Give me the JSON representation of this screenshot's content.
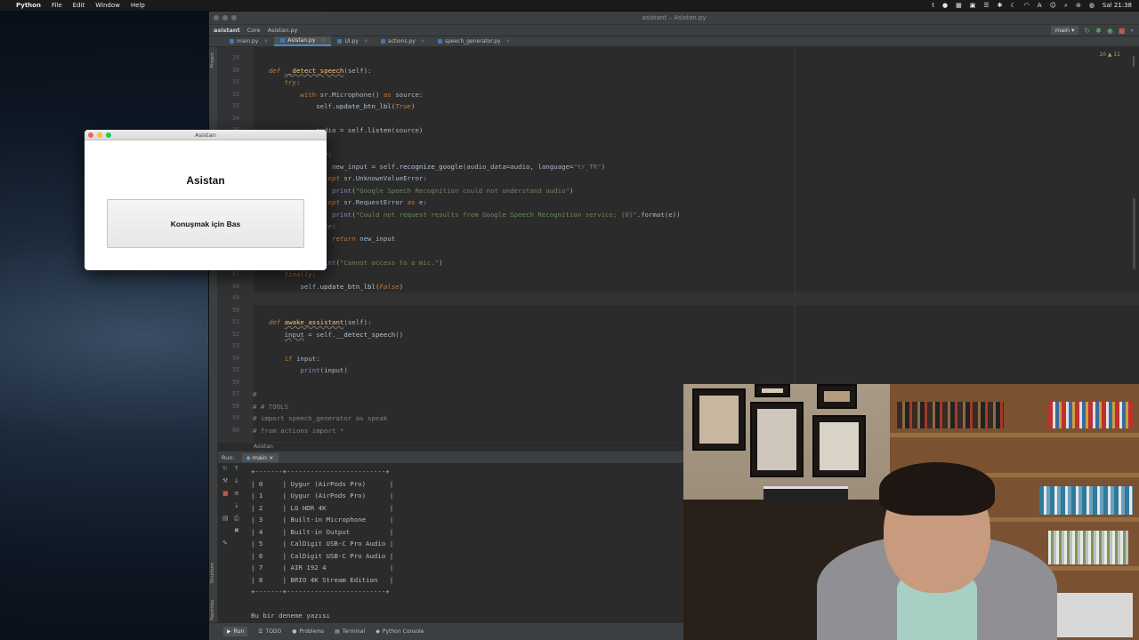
{
  "menubar": {
    "app": "Python",
    "items": [
      "File",
      "Edit",
      "Window",
      "Help"
    ],
    "clock": "Sal 21:38"
  },
  "ide": {
    "title": "asistant – Asistan.py",
    "breadcrumbs": [
      "asistant",
      "Core",
      "Asistan.py"
    ],
    "branch": "main",
    "tabs": [
      {
        "label": "main.py",
        "active": false
      },
      {
        "label": "Asistan.py",
        "active": true
      },
      {
        "label": "UI.py",
        "active": false
      },
      {
        "label": "actions.py",
        "active": false
      },
      {
        "label": "speech_generator.py",
        "active": false
      }
    ],
    "inspection": "10 ▲ 11",
    "left_tools": [
      "Project",
      "Structure",
      "Favorites"
    ],
    "code_lines": [
      {
        "n": "29",
        "html": ""
      },
      {
        "n": "30",
        "html": "    <span class='kw'>def</span> <span class='fn und'>__detect_speech</span>(<span class='id'>self</span>):"
      },
      {
        "n": "31",
        "html": "        <span class='kw'>try</span>:"
      },
      {
        "n": "32",
        "html": "            <span class='k2'>with</span> sr.Microphone() <span class='k2'>as</span> source:"
      },
      {
        "n": "33",
        "html": "                self.<span class='mt'>update_btn_lbl</span>(<span class='bool'>True</span>)"
      },
      {
        "n": "34",
        "html": ""
      },
      {
        "n": "35",
        "html": "                audio = self.<span class='mt'>listen</span>(source)"
      },
      {
        "n": "36",
        "html": ""
      },
      {
        "n": "37",
        "html": "                <span class='kw'>try</span>:"
      },
      {
        "n": "38",
        "html": "                    new_input = self.<span class='mt'>recognize_google</span>(audio_data=audio, language=<span class='str'>\"tr_TR\"</span>)"
      },
      {
        "n": "39",
        "html": "                <span class='kw'>except</span> sr.UnknownValueError:"
      },
      {
        "n": "40",
        "html": "                    <span class='bi'>print</span>(<span class='str'>\"Google Speech Recognition could not understand audio\"</span>)"
      },
      {
        "n": "41",
        "html": "                <span class='kw'>except</span> sr.RequestError <span class='k2'>as</span> e:"
      },
      {
        "n": "42",
        "html": "                    <span class='bi'>print</span>(<span class='str'>\"Could not request results from Google Speech Recognition service; {0}\"</span>.format(e))"
      },
      {
        "n": "43",
        "html": "                <span class='kw'>else</span>:"
      },
      {
        "n": "44",
        "html": "                    <span class='kw'>return</span> new_input"
      },
      {
        "n": "45",
        "html": ""
      },
      {
        "n": "46",
        "html": "                <span class='bi'>print</span>(<span class='str'>\"Cannot access to a mic.\"</span>)"
      },
      {
        "n": "47",
        "html": "        <span class='kw'>finally</span>:"
      },
      {
        "n": "48",
        "html": "            self.<span class='mt'>update_btn_lbl</span>(<span class='bool'>False</span>)"
      },
      {
        "n": "49",
        "html": "",
        "current": true
      },
      {
        "n": "50",
        "html": ""
      },
      {
        "n": "51",
        "html": "    <span class='kw'>def</span> <span class='fn und'>awake_assistant</span>(<span class='id'>self</span>):"
      },
      {
        "n": "52",
        "html": "        <span class='und'>input</span> = self.<span class='mt'>__detect_speech</span>()"
      },
      {
        "n": "53",
        "html": ""
      },
      {
        "n": "54",
        "html": "        <span class='k2'>if</span> input:"
      },
      {
        "n": "55",
        "html": "            <span class='bi'>print</span>(input)"
      },
      {
        "n": "56",
        "html": ""
      },
      {
        "n": "57",
        "html": "<span class='cmt'>#</span>"
      },
      {
        "n": "58",
        "html": "<span class='cmt'># # TOOLS</span>"
      },
      {
        "n": "59",
        "html": "<span class='cmt'># import speech_generator as speak</span>"
      },
      {
        "n": "60",
        "html": "<span class='cmt'># from actions import *</span>"
      }
    ],
    "editor_breadcrumb": "Asistan",
    "run": {
      "label": "Run:",
      "tab": "main",
      "console": [
        "+-------+-------------------------+",
        "| 0     | Uygur (AirPods Pro)      |",
        "| 1     | Uygur (AirPods Pro)      |",
        "| 2     | LG HDR 4K                |",
        "| 3     | Built-in Microphone      |",
        "| 4     | Built-in Output          |",
        "| 5     | CalDigit USB-C Pro Audio |",
        "| 6     | CalDigit USB-C Pro Audio |",
        "| 7     | AIR 192 4                |",
        "| 8     | BRIO 4K Stream Edition   |",
        "+-------+-------------------------+",
        "",
        "Bu bir deneme yazısı"
      ]
    },
    "status_tabs": [
      {
        "label": "Run",
        "icon": "▶",
        "active": true
      },
      {
        "label": "TODO",
        "icon": "☰",
        "active": false
      },
      {
        "label": "Problems",
        "icon": "●",
        "active": false
      },
      {
        "label": "Terminal",
        "icon": "▤",
        "active": false
      },
      {
        "label": "Python Console",
        "icon": "◆",
        "active": false
      }
    ]
  },
  "dialog": {
    "window_title": "Asistan",
    "heading": "Asistan",
    "button_label": "Konuşmak için Bas"
  },
  "colors": {
    "accent": "#4a88c7",
    "keyword": "#cc7832",
    "string": "#6a8759",
    "function": "#ffc66d"
  }
}
